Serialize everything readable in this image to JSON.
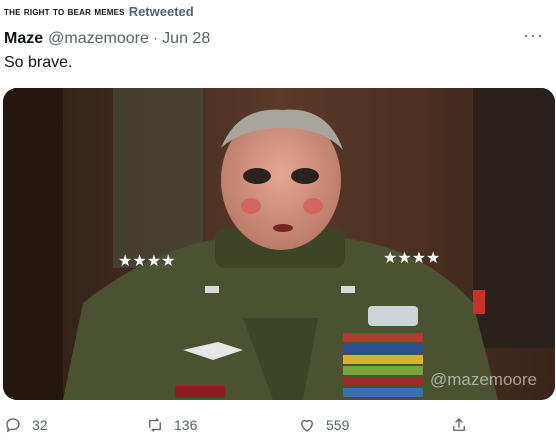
{
  "retweet": {
    "by": "the right to bear memes",
    "label": "Retweeted"
  },
  "tweet": {
    "author_name": "Maze",
    "handle": "@mazemoore",
    "separator": "·",
    "date": "Jun 28",
    "text": "So brave.",
    "more_label": "···"
  },
  "media": {
    "watermark": "@mazemoore",
    "icon": "photo-media"
  },
  "actions": {
    "reply_count": "32",
    "retweet_count": "136",
    "like_count": "559"
  },
  "colors": {
    "text": "#0f1419",
    "secondary": "#536471",
    "uniform": "#4a5231"
  }
}
